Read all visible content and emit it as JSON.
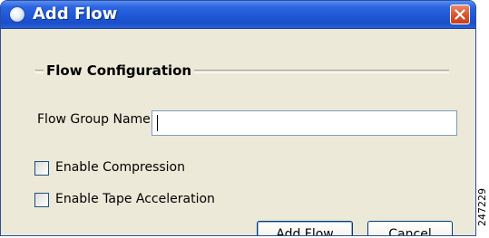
{
  "window": {
    "title": "Add Flow",
    "title_icon": "app-bullet-icon",
    "close_icon": "close-icon"
  },
  "group": {
    "title": "Flow Configuration"
  },
  "form": {
    "flow_group_label": "Flow Group Name:",
    "flow_group_value": "",
    "checkboxes": [
      {
        "label": "Enable Compression",
        "checked": false
      },
      {
        "label": "Enable Tape Acceleration",
        "checked": false
      }
    ]
  },
  "buttons": {
    "add_flow": "Add Flow",
    "cancel": "Cancel"
  },
  "figure_id": "247229",
  "colors": {
    "titlebar": "#1f58d6",
    "close_button": "#d8532e",
    "dialog_background": "#ece9d8"
  }
}
